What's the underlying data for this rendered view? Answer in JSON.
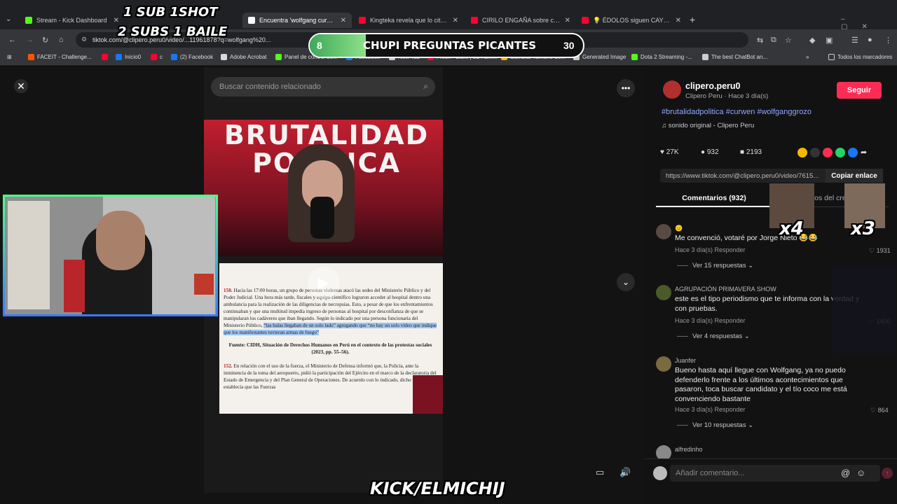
{
  "tabs": [
    {
      "title": "Stream - Kick Dashboard",
      "color": "#53fc18"
    },
    {
      "title": "Encuentra 'wolfgang curwen' en...",
      "color": "#ffffff"
    },
    {
      "title": "Kingteka revela que lo citaron p...",
      "color": "#ff0033"
    },
    {
      "title": "CIRILO ENGAÑA sobre cuanto ...",
      "color": "#ff0033"
    },
    {
      "title": "💡 ÉDOLOS siguen CAYENDO ...",
      "color": "#ff0033"
    }
  ],
  "address": {
    "url": "tiktok.com/@clipero.peru0/video/...11961878?q=wolfgang%20..."
  },
  "bookmarks": [
    {
      "label": "FACEIT - Challenge...",
      "color": "#ff5500"
    },
    {
      "label": "",
      "color": "#ff0033"
    },
    {
      "label": "Inicio0",
      "color": "#1877f2"
    },
    {
      "label": "c",
      "color": "#ff0033"
    },
    {
      "label": "(2) Facebook",
      "color": "#1877f2"
    },
    {
      "label": "Adobe Acrobat",
      "color": "#d9d9d9"
    },
    {
      "label": "Panel de control de...",
      "color": "#53fc18"
    },
    {
      "label": "Facebook",
      "color": "#1877f2"
    },
    {
      "label": "New Tab",
      "color": "#cccccc"
    },
    {
      "label": "Fresh - Baile | 3D Asm...",
      "color": "#ff0033"
    },
    {
      "label": "Cambiar Tamaño de...",
      "color": "#f4b400"
    },
    {
      "label": "Generated Image",
      "color": "#cccccc"
    },
    {
      "label": "Dota 2 Streaming -...",
      "color": "#53fc18"
    },
    {
      "label": "The best ChatBot an...",
      "color": "#cccccc"
    },
    {
      "label": "Todos los marcadores",
      "color": "#cccccc"
    }
  ],
  "overlay": {
    "sub_line1": "1 SUB  1SHOT",
    "sub_line2": "2 SUBS 1 BAILE",
    "poll_left": "8",
    "poll_title": "CHUPI PREGUNTAS PICANTES",
    "poll_right": "30",
    "channel": "KICK/ELMICHIJ",
    "mult_x4": "x4",
    "mult_x3": "x3"
  },
  "video": {
    "search_placeholder": "Buscar contenido relacionado",
    "banner": "BRUTALIDAD POLÍTICA",
    "doc_p150_num": "150.",
    "doc_p150_a": "Hacia las 17:00 horas, un grupo de personas violentas atacó las sedes del Ministerio Público y del Poder Judicial. Una hora más tarde, fiscales y equipo científico lograron acceder al hospital dentro una ambulancia para la realización de las diligencias de necropsias. Esto, a pesar de que los enfrentamientos continuaban y que una multitud impedía ingreso de personas al hospital por desconfianza de que se manipularan los cadáveres que iban llegando. Según lo indicado por una persona funcionaria del Ministerio Público,",
    "doc_p150_hl": "“las balas llegaban de un solo lado” agregando que “no hay un solo video que indique que los manifestantes tuvieran armas de fuego”",
    "doc_source": "Fuente: CIDH, Situación de Derechos Humanos en Perú en el contexto de las protestas sociales (2023, pp. 55–56).",
    "doc_p152_num": "152.",
    "doc_p152": "En relación con el uso de la fuerza, el Ministerio de Defensa informó que, la Policía, ante la inminencia de la toma del aeropuerto, pidió la participación del Ejército en el marco de la declaratoria del Estado de Emergencia y del Plan General de Operaciones. De acuerdo con lo indicado, dicho plan establecía que las Fuerzas"
  },
  "post": {
    "username": "clipero.peru0",
    "subline": "Clipero Peru · Hace 3 día(s)",
    "follow": "Seguir",
    "hashtags": "#brutalidadpolitica #curwen #wolfganggrozo",
    "sound": "sonido original - Clipero Peru",
    "likes": "27K",
    "comments": "932",
    "saves": "2193",
    "link": "https://www.tiktok.com/@clipero.peru0/video/7615...",
    "copy_link": "Copiar enlace",
    "tab_comments": "Comentarios (932)",
    "tab_creator": "Videos del creador"
  },
  "comments": [
    {
      "user": "😐",
      "text": "Me convenció, votaré por Jorge Nieto 😂😂",
      "meta": "Hace 3 día(s)    Responder",
      "likes": "1931",
      "replies": "Ver 15 respuestas ⌄"
    },
    {
      "user": "AGRUPACIÓN PRIMAVERA SHOW",
      "text": "este es el tipo periodismo que te informa con la verdad y con pruebas.",
      "meta": "Hace 3 día(s)    Responder",
      "likes": "1400",
      "replies": "Ver 4 respuestas ⌄"
    },
    {
      "user": "Juanfer",
      "text": "Bueno hasta aquí llegue con Wolfgang, ya no puedo defenderlo frente a los últimos acontecimientos que pasaron, toca buscar candidato y el tío coco me está convenciendo bastante",
      "meta": "Hace 3 día(s)    Responder",
      "likes": "864",
      "replies": "Ver 10 respuestas ⌄"
    },
    {
      "user": "alfredinho",
      "text": "",
      "meta": "",
      "likes": "",
      "replies": ""
    }
  ],
  "comment_input": {
    "placeholder": "Añadir comentario..."
  }
}
